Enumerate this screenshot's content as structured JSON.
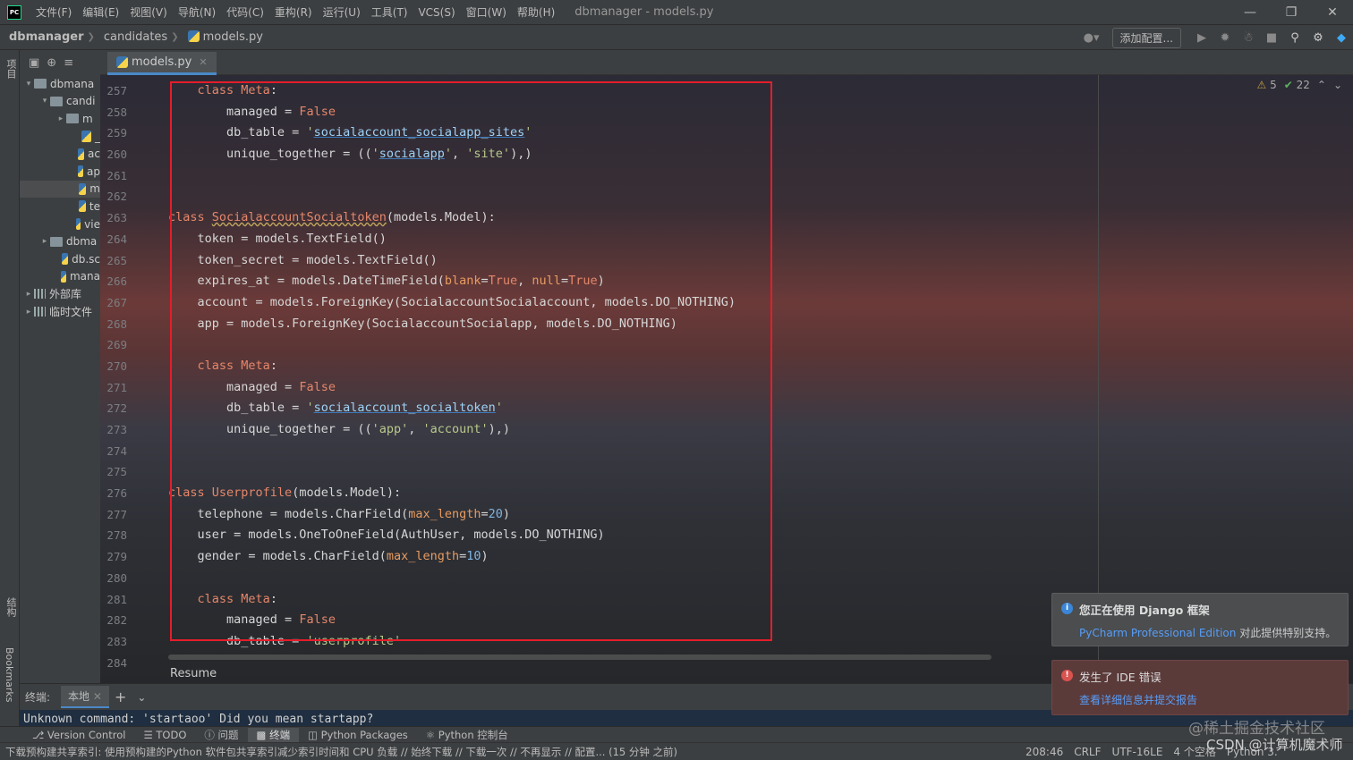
{
  "titlebar": {
    "menus": [
      "文件(F)",
      "编辑(E)",
      "视图(V)",
      "导航(N)",
      "代码(C)",
      "重构(R)",
      "运行(U)",
      "工具(T)",
      "VCS(S)",
      "窗口(W)",
      "帮助(H)"
    ],
    "window_title": "dbmanager - models.py"
  },
  "navbar": {
    "crumbs": [
      "dbmanager",
      "candidates",
      "models.py"
    ],
    "add_config": "添加配置..."
  },
  "left_strip": {
    "project": "项目",
    "structure": "结构",
    "bookmarks": "Bookmarks"
  },
  "project_tree": [
    {
      "label": "dbmana",
      "type": "folder",
      "arrow": "down"
    },
    {
      "label": "candi",
      "type": "folder",
      "arrow": "down"
    },
    {
      "label": "m",
      "type": "folder",
      "arrow": "right"
    },
    {
      "label": "_",
      "type": "py"
    },
    {
      "label": "ac",
      "type": "py"
    },
    {
      "label": "ap",
      "type": "py"
    },
    {
      "label": "m",
      "type": "py",
      "selected": true
    },
    {
      "label": "te",
      "type": "py"
    },
    {
      "label": "vie",
      "type": "py"
    },
    {
      "label": "dbma",
      "type": "folder",
      "arrow": "right"
    },
    {
      "label": "db.sc",
      "type": "py"
    },
    {
      "label": "mana",
      "type": "py"
    },
    {
      "label": "外部库",
      "type": "lib",
      "arrow": "right"
    },
    {
      "label": "临时文件",
      "type": "lib",
      "arrow": "right"
    }
  ],
  "editor": {
    "tab_label": "models.py",
    "warnings": "5",
    "ok_count": "22",
    "resume": "Resume",
    "line_numbers": [
      "257",
      "258",
      "259",
      "260",
      "261",
      "262",
      "263",
      "264",
      "265",
      "266",
      "267",
      "268",
      "269",
      "270",
      "271",
      "272",
      "273",
      "274",
      "275",
      "276",
      "277",
      "278",
      "279",
      "280",
      "281",
      "282",
      "283",
      "284"
    ]
  },
  "terminal": {
    "label": "终端:",
    "tab": "本地",
    "output": "Unknown command: 'startaoo'  Did you mean startapp?"
  },
  "toolwindows": [
    "Version Control",
    "TODO",
    "问题",
    "终端",
    "Python Packages",
    "Python 控制台"
  ],
  "statusbar": {
    "message": "下载预构建共享索引: 使用预构建的Python 软件包共享索引减少索引时间和 CPU 负载 // 始终下载 // 下载一次 // 不再显示 // 配置... (15 分钟 之前)",
    "position": "208:46",
    "line_sep": "CRLF",
    "encoding": "UTF-16LE",
    "indent": "4 个空格",
    "interpreter": "Python 3."
  },
  "notifications": {
    "django_title": "您正在使用 Django 框架",
    "django_link": "PyCharm Professional Edition",
    "django_body": "对此提供特别支持。",
    "error_title": "发生了 IDE 错误",
    "error_link": "查看详细信息并提交报告"
  },
  "watermarks": {
    "line1": "@稀土掘金技术社区",
    "line2": "CSDN @计算机魔术师"
  }
}
